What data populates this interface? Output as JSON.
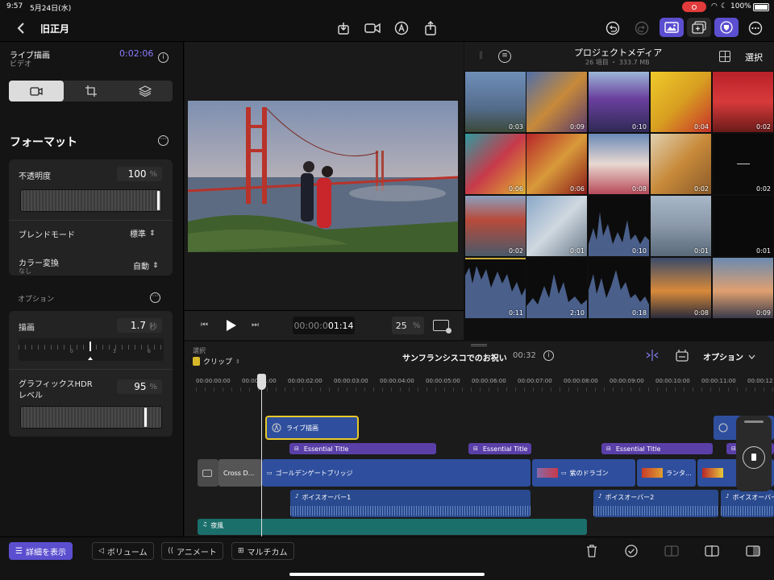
{
  "status": {
    "time": "9:57",
    "date": "5月24日(水)",
    "battery": "100%"
  },
  "project": {
    "title": "旧正月"
  },
  "inspector": {
    "clip_name": "ライブ描画",
    "clip_type": "ビデオ",
    "clip_duration": "0:02:06",
    "section_title": "フォーマット",
    "opacity_label": "不透明度",
    "opacity_value": "100",
    "opacity_unit": "%",
    "blend_label": "ブレンドモード",
    "blend_value": "標準",
    "color_label": "カラー変換",
    "color_sub": "なし",
    "color_value": "自動",
    "options_label": "オプション",
    "draw_label": "描画",
    "draw_value": "1.7",
    "draw_unit": "秒",
    "draw_scale": [
      "0",
      "3",
      "6"
    ],
    "hdr_label_1": "グラフィックスHDR",
    "hdr_label_2": "レベル",
    "hdr_value": "95",
    "hdr_unit": "%"
  },
  "viewer": {
    "timecode_prefix": "00:00:0",
    "timecode_main": "01:14",
    "zoom": "25",
    "zoom_unit": "%"
  },
  "browser": {
    "title": "プロジェクトメディア",
    "subtitle": "26 項目 ・ 333.7 MB",
    "select_label": "選択",
    "durations": [
      "0:03",
      "0:09",
      "0:10",
      "0:04",
      "0:02",
      "0:06",
      "0:06",
      "0:08",
      "0:02",
      "0:02",
      "0:02",
      "0:01",
      "0:10",
      "0:01",
      "0:01",
      "0:11",
      "2:10",
      "0:18",
      "0:08",
      "0:09"
    ]
  },
  "timeline": {
    "select_label": "選択",
    "select_mode": "クリップ",
    "project_name": "サンフランシスコでのお祝い",
    "project_duration": "00:32",
    "options_label": "オプション",
    "ruler": [
      "00:00:00:00",
      "00:00:01:00",
      "00:00:02:00",
      "00:00:03:00",
      "00:00:04:00",
      "00:00:05:00",
      "00:00:06:00",
      "00:00:07:00",
      "00:00:08:00",
      "00:00:09:00",
      "00:00:10:00",
      "00:00:11:00",
      "00:00:12"
    ],
    "live_clip": "ライブ描画",
    "titles": [
      "Essential Title",
      "Essential Title",
      "Essential Title"
    ],
    "transition": "Cross D...",
    "main_clips": [
      "ゴールデンゲートブリッジ",
      "紫のドラゴン",
      "ランタ..."
    ],
    "voiceovers": [
      "ボイスオーバー1",
      "ボイスオーバー2",
      "ボイスオーバー"
    ],
    "music": "夜風"
  },
  "bottom": {
    "details": "詳細を表示",
    "volume": "ボリューム",
    "animate": "アニメート",
    "multicam": "マルチカム"
  },
  "colors": {
    "accent": "#5b4fd0",
    "timecode": "#8a7cff",
    "clip_blue": "#2f4f9e",
    "title_purple": "#5a3fa8",
    "audio": "#2a4a8f",
    "music": "#1b6f6a"
  }
}
